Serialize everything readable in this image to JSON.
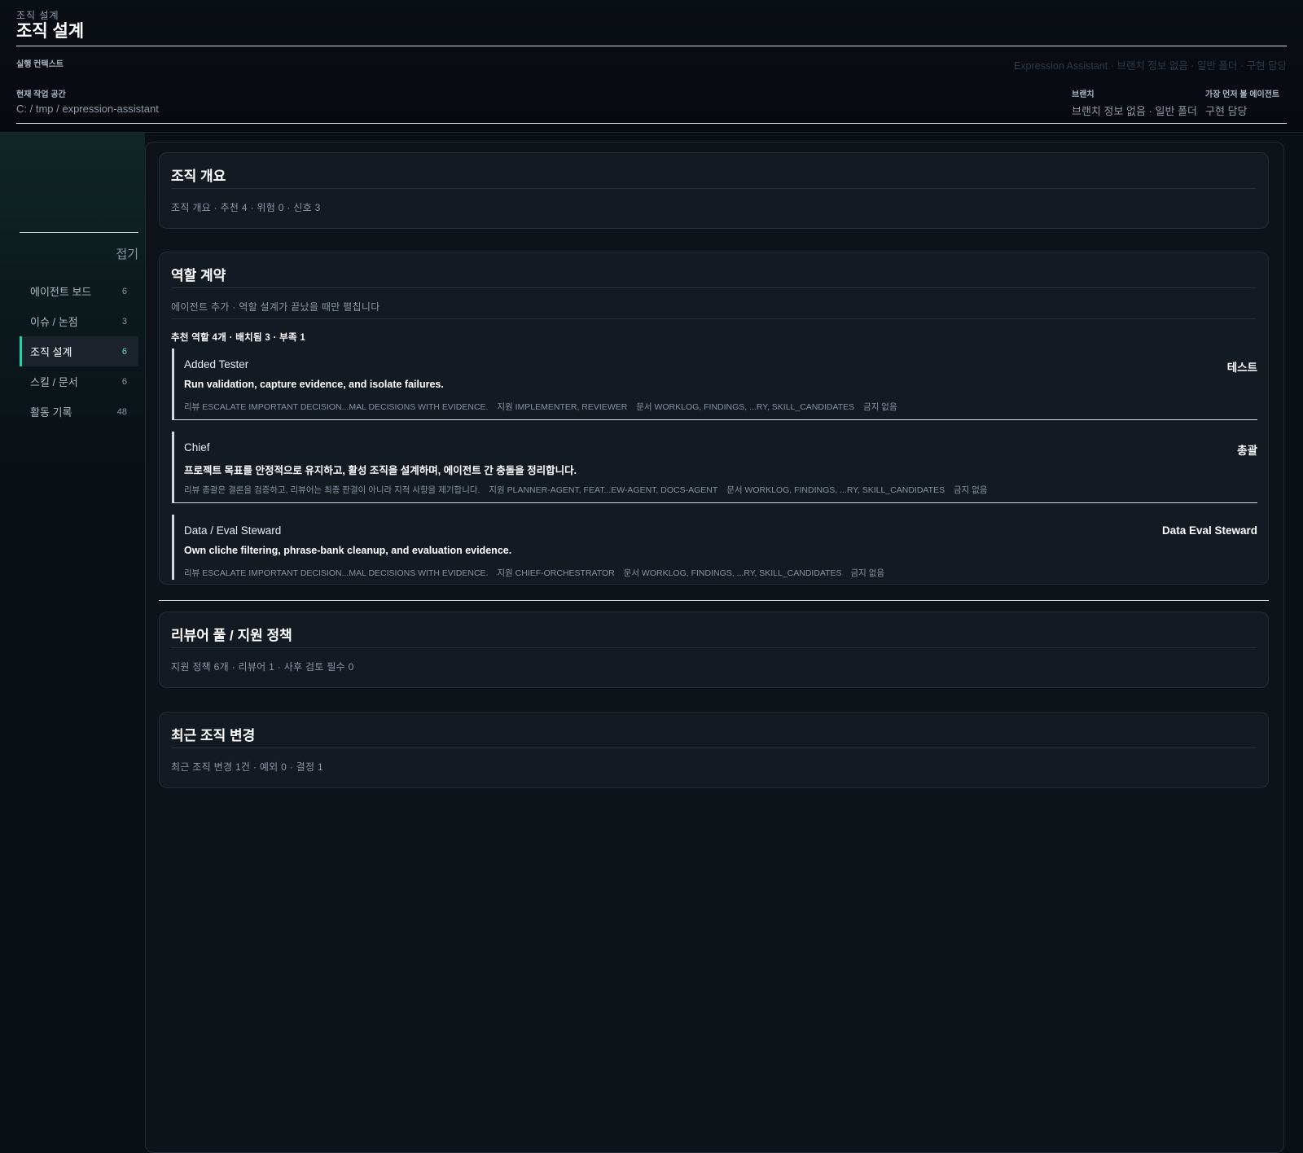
{
  "header": {
    "breadcrumb": "조직 설계",
    "title": "조직 설계",
    "context_label": "실행 컨텍스트",
    "context_summary": "Expression Assistant · 브랜치 정보 없음 · 일반 폴더 · 구현 담당",
    "workspace_label": "현재 작업 공간",
    "workspace_value": "C: / tmp / expression-assistant",
    "branch_label": "브랜치",
    "branch_value": "브랜치 정보 없음 · 일반 폴더",
    "first_agent_label": "가장 먼저 볼 에이전트",
    "first_agent_value": "구현 담당"
  },
  "sidebar": {
    "collapse_label": "접기",
    "items": [
      {
        "label": "에이전트 보드",
        "count": "6"
      },
      {
        "label": "이슈 / 논점",
        "count": "3"
      },
      {
        "label": "조직 설계",
        "count": "6",
        "active": true
      },
      {
        "label": "스킬 / 문서",
        "count": "6"
      },
      {
        "label": "활동 기록",
        "count": "48"
      }
    ]
  },
  "overview": {
    "title": "조직 개요",
    "summary": "조직 개요 · 추천 4 · 위험 0 · 신호 3"
  },
  "roles": {
    "title": "역할 계약",
    "hint": "에이전트 추가 · 역할 설계가 끝났을 때만 펼칩니다",
    "recommend": "추천 역할 4개 · 배치됨 3 · 부족 1",
    "items": [
      {
        "name": "Added Tester",
        "tag": "테스트",
        "desc": "Run validation, capture evidence, and isolate failures.",
        "review": "리뷰 ESCALATE IMPORTANT DECISION...MAL DECISIONS WITH EVIDENCE.",
        "support": "지원 IMPLEMENTER, REVIEWER",
        "docs": "문서 WORKLOG, FINDINGS, ...RY, SKILL_CANDIDATES",
        "forbid": "금지 없음"
      },
      {
        "name": "Chief",
        "tag": "총괄",
        "desc": "프로젝트 목표를 안정적으로 유지하고, 활성 조직을 설계하며, 에이전트 간 충돌을 정리합니다.",
        "review": "리뷰 총괄은 결론을 검증하고, 리뷰어는 최종 판결이 아니라 지적 사항을 제기합니다.",
        "support": "지원 PLANNER-AGENT, FEAT...EW-AGENT, DOCS-AGENT",
        "docs": "문서 WORKLOG, FINDINGS, ...RY, SKILL_CANDIDATES",
        "forbid": "금지 없음"
      },
      {
        "name": "Data / Eval Steward",
        "tag": "Data Eval Steward",
        "desc": "Own cliche filtering, phrase-bank cleanup, and evaluation evidence.",
        "review": "리뷰 ESCALATE IMPORTANT DECISION...MAL DECISIONS WITH EVIDENCE.",
        "support": "지원 CHIEF-ORCHESTRATOR",
        "docs": "문서 WORKLOG, FINDINGS, ...RY, SKILL_CANDIDATES",
        "forbid": "금지 없음"
      }
    ]
  },
  "reviewer_pool": {
    "title": "리뷰어 풀 / 지원 정책",
    "summary": "지원 정책 6개 · 리뷰어 1 · 사후 검토 필수 0"
  },
  "recent_changes": {
    "title": "최근 조직 변경",
    "summary": "최근 조직 변경 1건 · 예외 0 · 결정 1"
  },
  "colors": {
    "accent": "#23d3a0",
    "background": "#0b1016",
    "card": "#141a22"
  }
}
